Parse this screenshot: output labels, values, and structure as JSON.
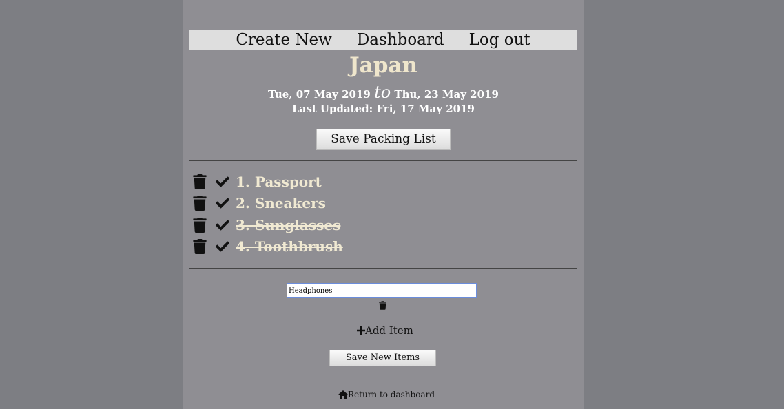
{
  "nav": {
    "create_new": "Create New",
    "dashboard": "Dashboard",
    "log_out": "Log out"
  },
  "trip": {
    "title": "Japan",
    "start_date": "Tue, 07 May 2019",
    "to_word": "to",
    "end_date": "Thu, 23 May 2019",
    "last_updated": "Last Updated: Fri, 17 May 2019"
  },
  "buttons": {
    "save_packing_list": "Save Packing List",
    "add_item": "Add Item",
    "save_new_items": "Save New Items",
    "return_dashboard": "Return to dashboard"
  },
  "items": [
    {
      "label": "1. Passport",
      "packed": false
    },
    {
      "label": "2. Sneakers",
      "packed": false
    },
    {
      "label": "3. Sunglasses",
      "packed": true
    },
    {
      "label": "4. Toothbrush",
      "packed": true
    }
  ],
  "new_item": {
    "value": "Headphones"
  },
  "icons": {
    "trash": "trash-icon",
    "check": "check-icon",
    "plus": "plus-icon",
    "home": "home-icon"
  },
  "colors": {
    "background": "#7d7e83",
    "page": "#8f8e93",
    "nav_bar": "#dedede",
    "title_text": "#efe6cc",
    "input_border": "#6b8ddc"
  }
}
